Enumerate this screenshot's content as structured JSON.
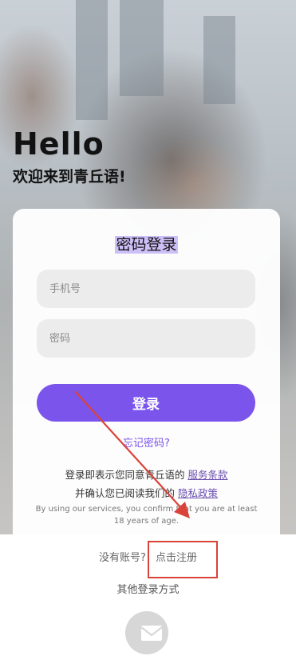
{
  "header": {
    "hello": "Hello",
    "welcome": "欢迎来到青丘语!"
  },
  "login": {
    "title": "密码登录",
    "phone_placeholder": "手机号",
    "password_placeholder": "密码",
    "submit_label": "登录",
    "forgot_label": "忘记密码?"
  },
  "terms": {
    "line1_prefix": "登录即表示您同意青丘语的",
    "service_link": "服务条款",
    "line2_prefix": "并确认您已阅读我们的",
    "privacy_link": "隐私政策",
    "english": "By using our services, you confirm that you are at least 18 years of age."
  },
  "register": {
    "prompt": "没有账号?",
    "link": "点击注册"
  },
  "other_login": {
    "label": "其他登录方式",
    "icon": "mail-icon"
  },
  "colors": {
    "accent": "#7b54ec",
    "annotation": "#d9433a"
  }
}
